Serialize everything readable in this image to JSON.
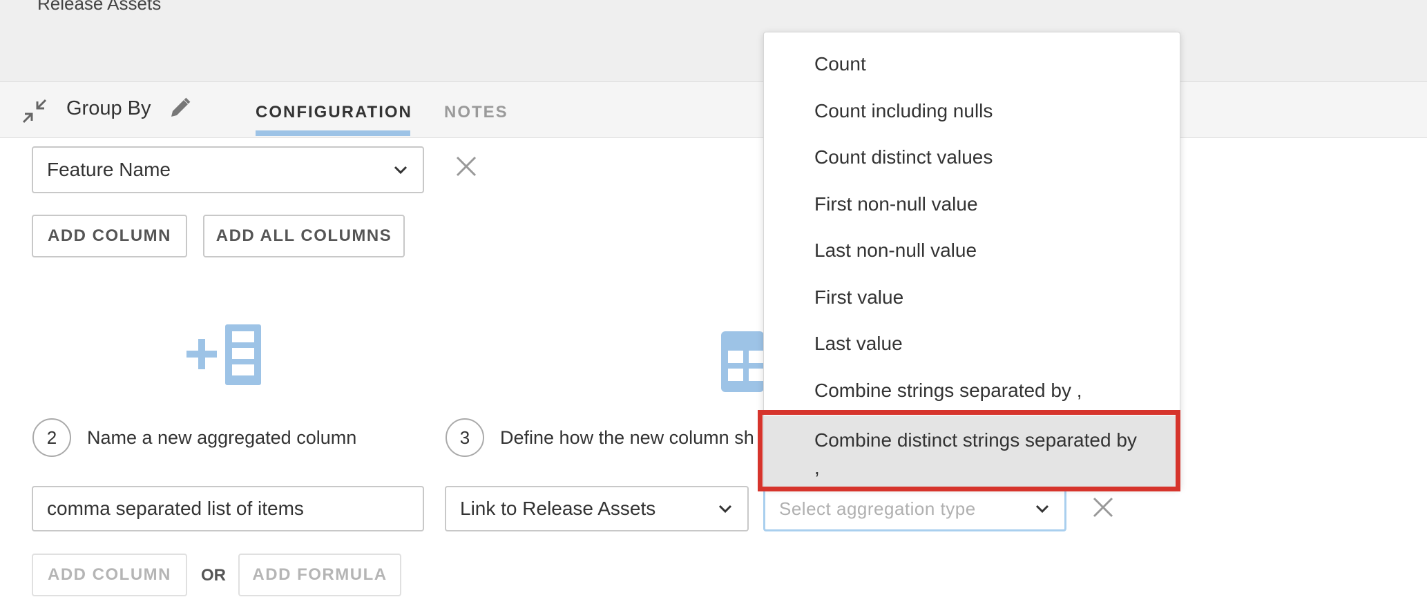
{
  "header": {
    "breadcrumb": "Release Assets"
  },
  "step_bar": {
    "title": "Group By",
    "tabs": [
      {
        "label": "CONFIGURATION",
        "active": true
      },
      {
        "label": "NOTES",
        "active": false
      }
    ]
  },
  "group_section": {
    "column_select": {
      "value": "Feature Name"
    },
    "add_column": "ADD COLUMN",
    "add_all_columns": "ADD ALL COLUMNS"
  },
  "aggregate_section": {
    "step2": {
      "number": "2",
      "label": "Name a new aggregated column"
    },
    "step3": {
      "number": "3",
      "label": "Define how the new column sh"
    },
    "name_input": {
      "value": "comma separated list of items"
    },
    "link_select": {
      "value": "Link to Release Assets"
    },
    "aggregation_select": {
      "placeholder": "Select aggregation type"
    },
    "add_column": "ADD COLUMN",
    "or_label": "OR",
    "add_formula": "ADD FORMULA"
  },
  "aggregation_dropdown": {
    "options": [
      "Count",
      "Count including nulls",
      "Count distinct values",
      "First non-null value",
      "Last non-null value",
      "First value",
      "Last value",
      "Combine strings separated by ,",
      "Combine distinct strings separated by ,"
    ],
    "highlighted_index": 8
  },
  "colors": {
    "accent_blue": "#9dc3e6",
    "highlight_border": "#d6342c",
    "dropdown_hover": "#e4e4e4"
  }
}
